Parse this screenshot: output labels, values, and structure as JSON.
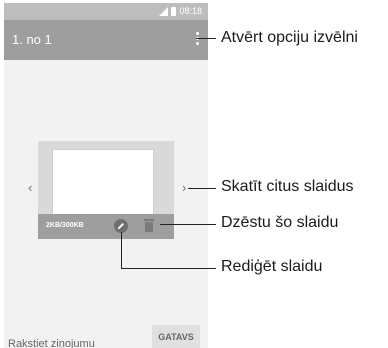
{
  "status_bar": {
    "time": "08:18"
  },
  "app_bar": {
    "title": "1. no 1"
  },
  "slide_card": {
    "size_text": "2KB/300KB"
  },
  "composer": {
    "message_placeholder": "Rakstiet ziņojumu",
    "done_label": "GATAVS"
  },
  "navigation": {
    "prev_symbol": "‹",
    "next_symbol": "›"
  },
  "callouts": {
    "options_menu": "Atvērt opciju izvēlni",
    "view_slides": "Skatīt citus slaidus",
    "delete_slide": "Dzēstu šo slaidu",
    "edit_slide": "Rediģēt slaidu"
  },
  "icons": {
    "signal": "signal-icon",
    "battery": "battery-icon",
    "overflow": "more-vert-icon",
    "edit": "pencil-icon",
    "delete": "trash-icon"
  }
}
